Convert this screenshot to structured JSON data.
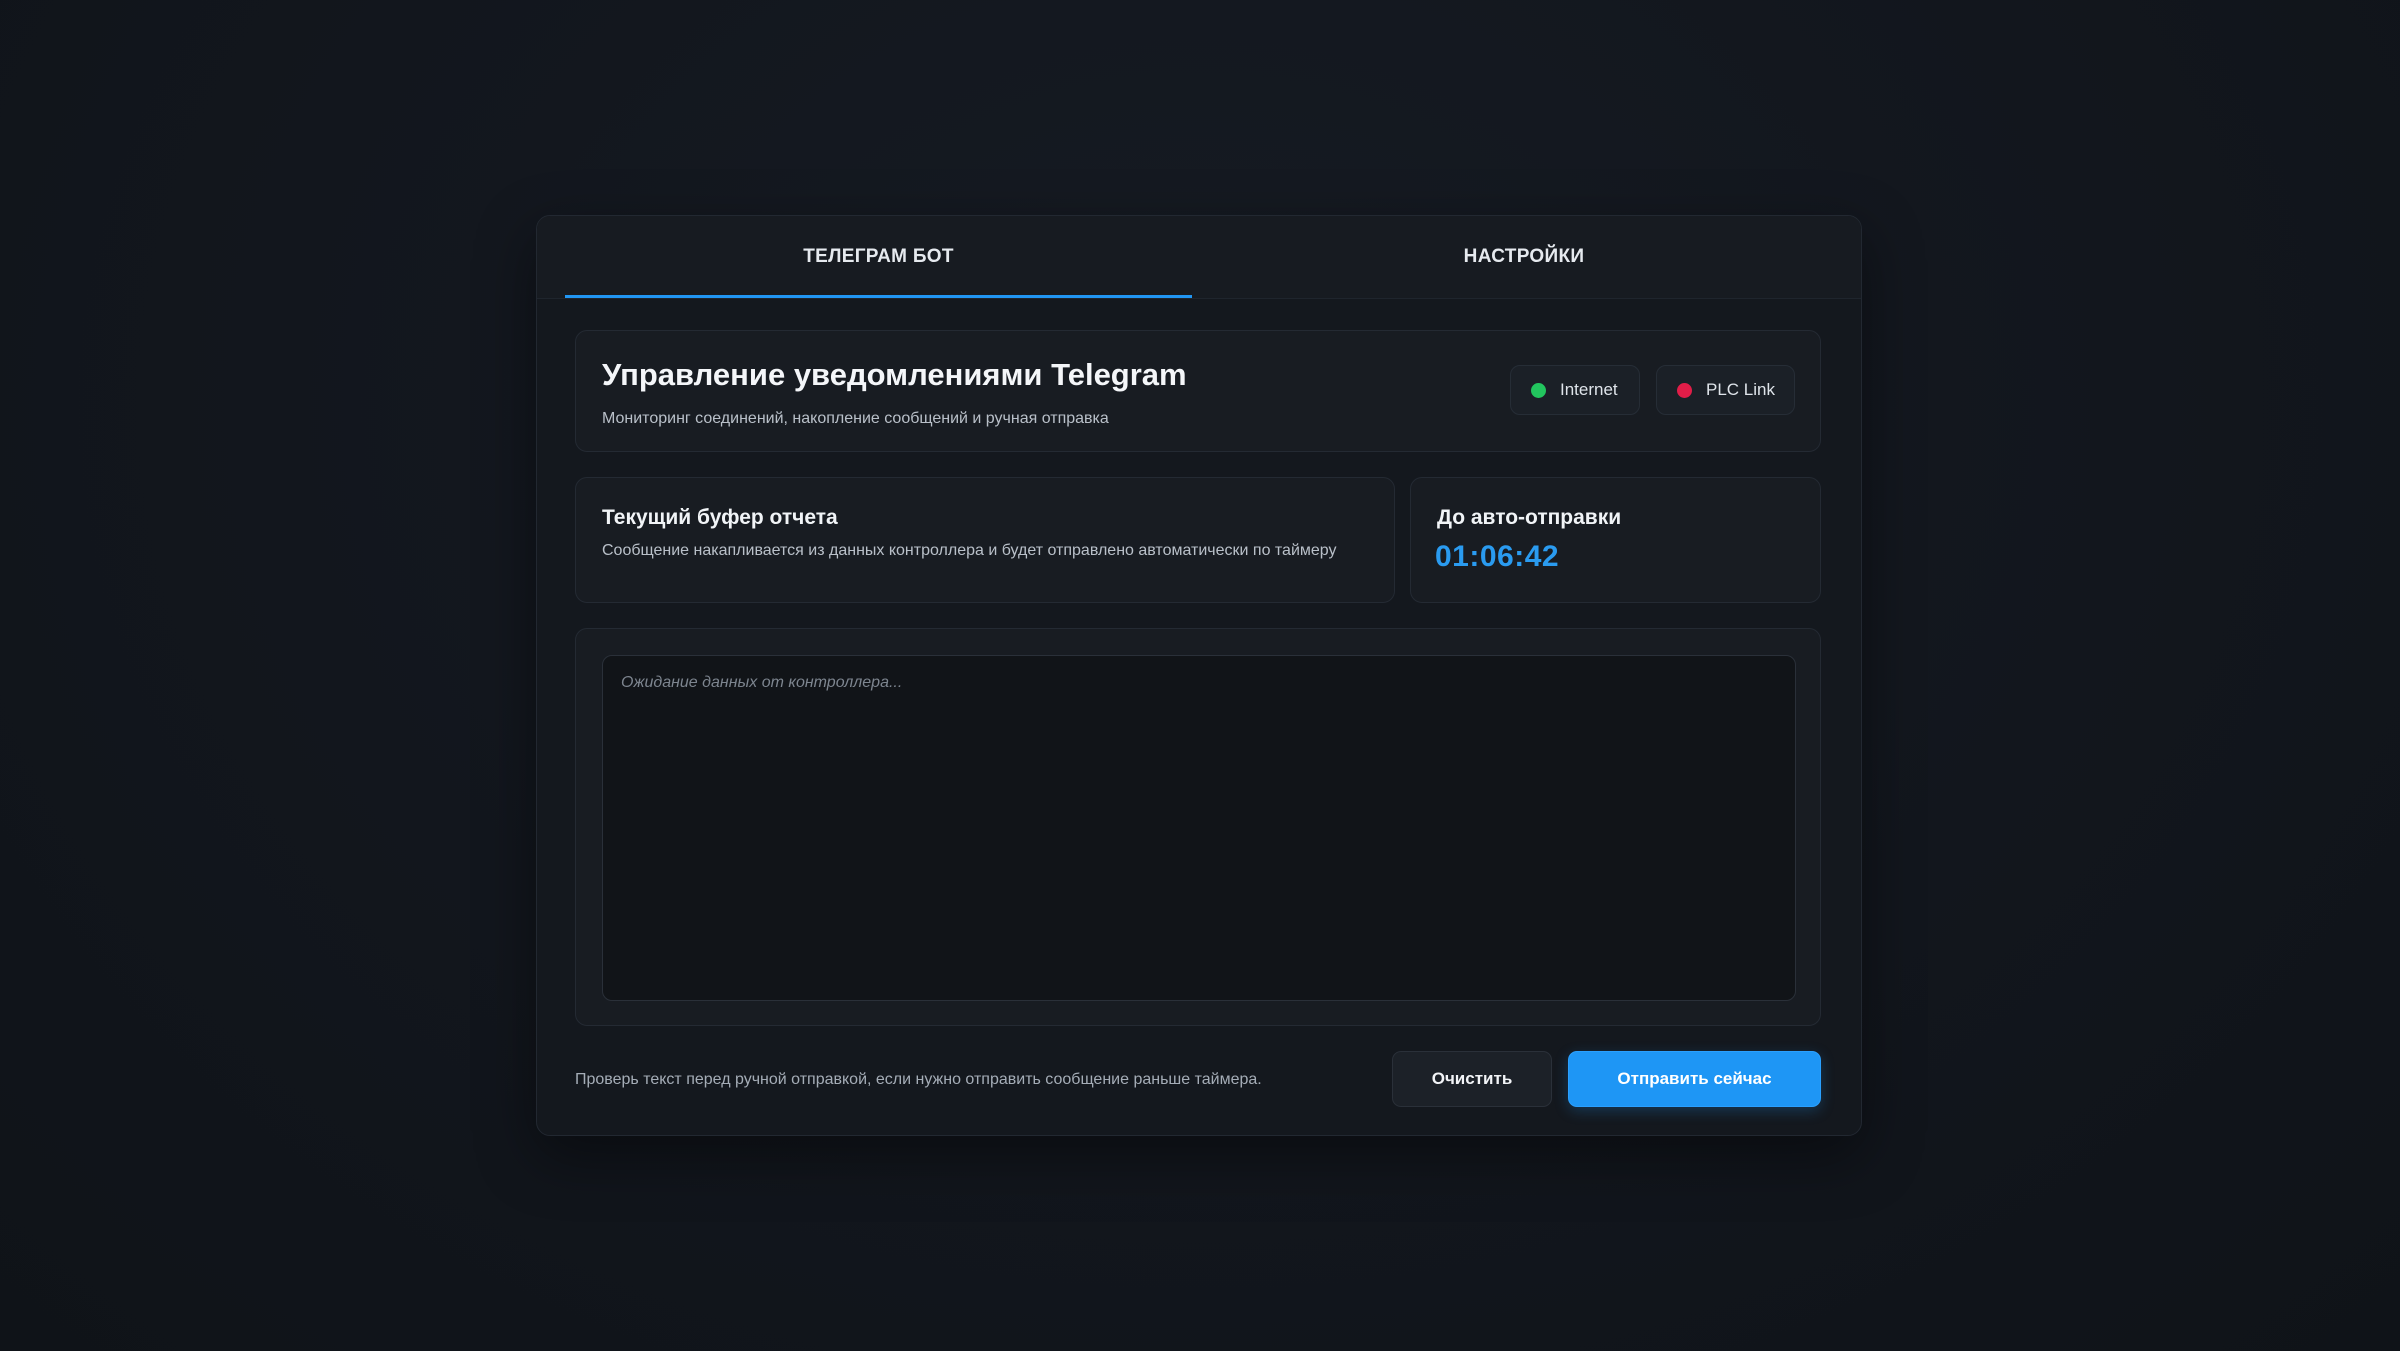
{
  "tabs": [
    {
      "label": "ТЕЛЕГРАМ БОТ",
      "active": true
    },
    {
      "label": "НАСТРОЙКИ",
      "active": false
    }
  ],
  "header": {
    "title": "Управление уведомлениями Telegram",
    "subtitle": "Мониторинг соединений, накопление сообщений и ручная отправка"
  },
  "status": {
    "internet": {
      "label": "Internet",
      "color": "#22c55e",
      "icon": "status-dot"
    },
    "plc": {
      "label": "PLC Link",
      "color": "#e11d48",
      "icon": "status-dot"
    }
  },
  "buffer": {
    "title": "Текущий буфер отчета",
    "description": "Сообщение накапливается из данных контроллера и будет отправлено автоматически по таймеру"
  },
  "timer": {
    "title": "До авто-отправки",
    "value": "01:06:42"
  },
  "editor": {
    "value": "",
    "placeholder": "Ожидание данных от контроллера..."
  },
  "footer": {
    "hint": "Проверь текст перед ручной отправкой, если нужно отправить сообщение раньше таймера.",
    "clear_label": "Очистить",
    "send_label": "Отправить сейчас"
  },
  "colors": {
    "accent": "#2196f3",
    "timer": "#2a9bf0"
  }
}
